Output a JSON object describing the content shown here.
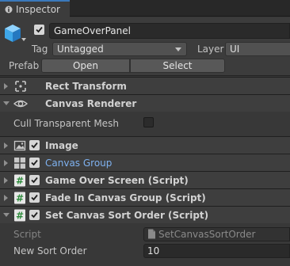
{
  "tab": {
    "label": "Inspector",
    "icon": "info-icon"
  },
  "gameobject": {
    "icon": "cube-icon",
    "active": true,
    "name": "GameOverPanel",
    "tag_label": "Tag",
    "tag_value": "Untagged",
    "layer_label": "Layer",
    "layer_value": "UI",
    "prefab_label": "Prefab",
    "open_label": "Open",
    "select_label": "Select"
  },
  "components": [
    {
      "name": "Rect Transform",
      "icon": "rect-transform-icon",
      "expanded": false,
      "has_checkbox": false
    },
    {
      "name": "Canvas Renderer",
      "icon": "eye-icon",
      "expanded": true,
      "has_checkbox": false
    },
    {
      "name": "Image",
      "icon": "image-icon",
      "expanded": false,
      "has_checkbox": true,
      "enabled": true
    },
    {
      "name": "Canvas Group",
      "icon": "canvas-group-icon",
      "expanded": false,
      "has_checkbox": true,
      "enabled": true
    },
    {
      "name": "Game Over Screen (Script)",
      "icon": "script-icon",
      "expanded": false,
      "has_checkbox": true,
      "enabled": true
    },
    {
      "name": "Fade In Canvas Group (Script)",
      "icon": "script-icon",
      "expanded": false,
      "has_checkbox": true,
      "enabled": true
    },
    {
      "name": "Set Canvas Sort Order (Script)",
      "icon": "script-icon",
      "expanded": true,
      "has_checkbox": true,
      "enabled": true
    }
  ],
  "canvas_renderer": {
    "cull_label": "Cull Transparent Mesh",
    "cull_value": false
  },
  "set_canvas_sort_order": {
    "script_label": "Script",
    "script_value": "SetCanvasSortOrder",
    "sort_order_label": "New Sort Order",
    "sort_order_value": "10"
  },
  "colors": {
    "background": "#383838",
    "header": "#3e3e3e",
    "accent_blue": "#3a79bb",
    "link_blue": "#7fb2f0"
  }
}
